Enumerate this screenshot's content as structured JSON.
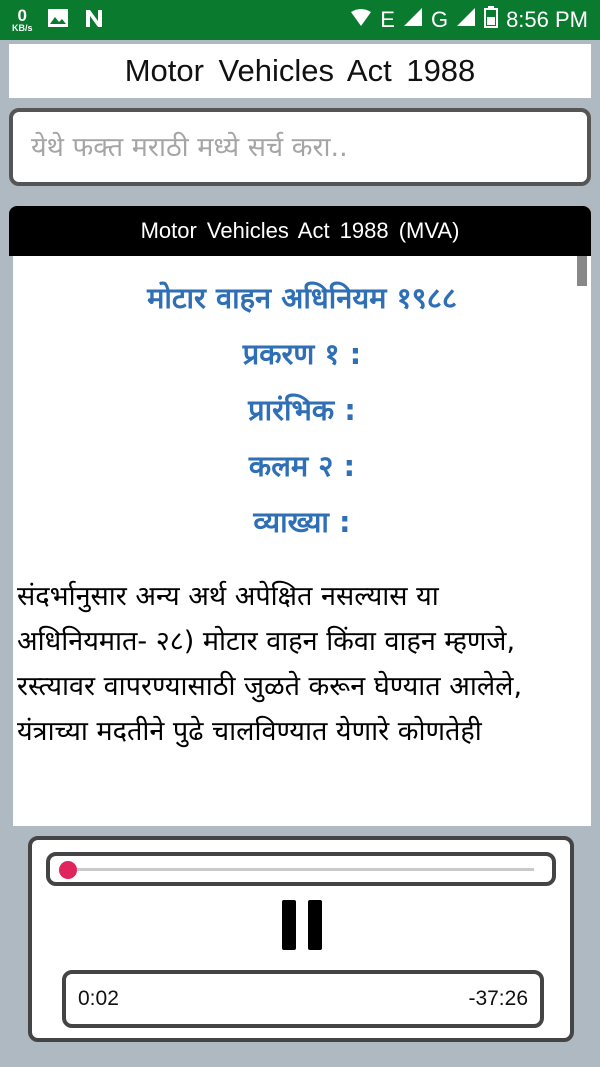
{
  "status_bar": {
    "net_speed_value": "0",
    "net_speed_unit": "KB/s",
    "network_label_e": "E",
    "network_label_g": "G",
    "time": "8:56 PM",
    "bg_color": "#0a7a2f"
  },
  "header": {
    "title": "Motor Vehicles Act 1988"
  },
  "search": {
    "placeholder": "येथे फक्त मराठी मध्ये सर्च करा.."
  },
  "content": {
    "header_title": "Motor Vehicles Act 1988 (MVA)",
    "headings": [
      "मोटार वाहन अधिनियम १९८८",
      "प्रकरण १ :",
      "प्रारंभिक :",
      "कलम २ :",
      "व्याख्या :"
    ],
    "heading_color": "#2f6fb6",
    "body": "संदर्भानुसार अन्य अर्थ अपेक्षित नसल्यास या अधिनियमात- २८) मोटार वाहन किंवा वाहन म्हणजे, रस्त्यावर वापरण्यासाठी जुळते करून घेण्यात आलेले, यंत्राच्या मदतीने पुढे चालविण्यात येणारे कोणतेही"
  },
  "player": {
    "current_time": "0:02",
    "remaining_time": "-37:26",
    "progress_percent": 0.1,
    "accent_color": "#e0245e",
    "control_icon": "pause-icon"
  }
}
